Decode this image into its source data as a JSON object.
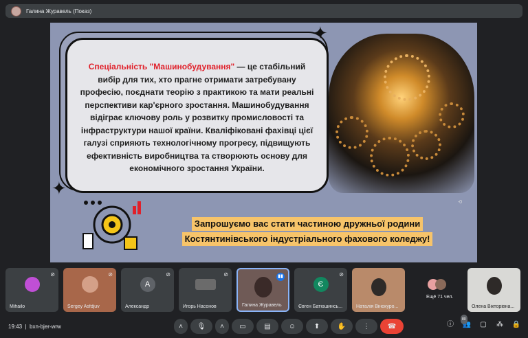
{
  "header": {
    "presenter": "Галина Журавель (Показ)"
  },
  "slide": {
    "highlight": "Спеціальність \"Машинобудування\"",
    "body": " — це стабільний вибір для тих, хто прагне отримати затребувану професію, поєднати теорію з практикою та мати реальні перспективи кар'єрного зростання. Машинобудування відіграє ключову роль у розвитку промисловості та інфраструктури нашої країни. Кваліфіковані фахівці цієї галузі сприяють технологічному прогресу, підвищують ефективність виробництва та створюють основу для економічного зростання України.",
    "cta_line1": "Запрошуємо вас стати частиною дружньої родини",
    "cta_line2": "Костянтинівського індустріального фахового коледжу!",
    "corner_mark": "-0"
  },
  "participants": [
    {
      "name": "Mihailo",
      "initial": "",
      "color": "#c04fd6"
    },
    {
      "name": "Sergey Asfdjuv",
      "initial": "",
      "color": "#d06a3c"
    },
    {
      "name": "Александр",
      "initial": "А",
      "color": "#5f6368"
    },
    {
      "name": "Игорь Насонов",
      "initial": "",
      "color": "#6b6b6b"
    },
    {
      "name": "Галина Журавель",
      "initial": "",
      "color": "#8a6d6a"
    },
    {
      "name": "Євген Батюшинсь...",
      "initial": "Є",
      "color": "#12875f"
    },
    {
      "name": "Наталія Вінокуро...",
      "initial": "",
      "color": "#b98a6a"
    },
    {
      "name": "Ещё 71 чел.",
      "initial": "",
      "color": "#3c4043"
    },
    {
      "name": "Олена Вікторівна...",
      "initial": "",
      "color": "#e9e9e9"
    }
  ],
  "footer": {
    "time": "19:43",
    "separator": "|",
    "code": "bxn-bjer-wrw",
    "people_count": "80"
  },
  "icons": {
    "mic": "mic-icon",
    "camera": "camera-icon",
    "captions": "captions-icon",
    "emoji": "emoji-icon",
    "present": "present-icon",
    "hand": "raise-hand-icon",
    "more": "more-icon",
    "end": "end-call-icon"
  }
}
